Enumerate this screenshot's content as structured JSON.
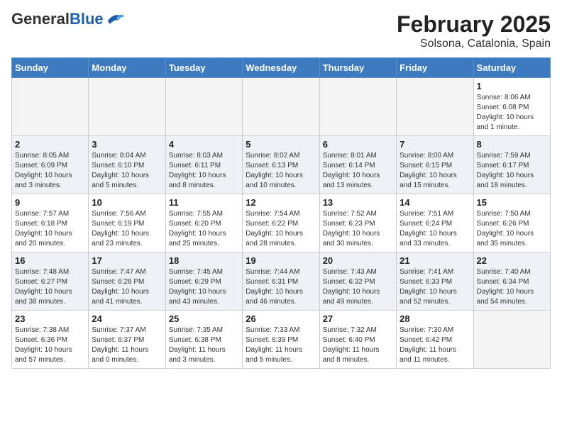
{
  "logo": {
    "general": "General",
    "blue": "Blue"
  },
  "title": "February 2025",
  "location": "Solsona, Catalonia, Spain",
  "days_of_week": [
    "Sunday",
    "Monday",
    "Tuesday",
    "Wednesday",
    "Thursday",
    "Friday",
    "Saturday"
  ],
  "weeks": [
    [
      {
        "day": "",
        "info": ""
      },
      {
        "day": "",
        "info": ""
      },
      {
        "day": "",
        "info": ""
      },
      {
        "day": "",
        "info": ""
      },
      {
        "day": "",
        "info": ""
      },
      {
        "day": "",
        "info": ""
      },
      {
        "day": "1",
        "info": "Sunrise: 8:06 AM\nSunset: 6:08 PM\nDaylight: 10 hours\nand 1 minute."
      }
    ],
    [
      {
        "day": "2",
        "info": "Sunrise: 8:05 AM\nSunset: 6:09 PM\nDaylight: 10 hours\nand 3 minutes."
      },
      {
        "day": "3",
        "info": "Sunrise: 8:04 AM\nSunset: 6:10 PM\nDaylight: 10 hours\nand 5 minutes."
      },
      {
        "day": "4",
        "info": "Sunrise: 8:03 AM\nSunset: 6:11 PM\nDaylight: 10 hours\nand 8 minutes."
      },
      {
        "day": "5",
        "info": "Sunrise: 8:02 AM\nSunset: 6:13 PM\nDaylight: 10 hours\nand 10 minutes."
      },
      {
        "day": "6",
        "info": "Sunrise: 8:01 AM\nSunset: 6:14 PM\nDaylight: 10 hours\nand 13 minutes."
      },
      {
        "day": "7",
        "info": "Sunrise: 8:00 AM\nSunset: 6:15 PM\nDaylight: 10 hours\nand 15 minutes."
      },
      {
        "day": "8",
        "info": "Sunrise: 7:59 AM\nSunset: 6:17 PM\nDaylight: 10 hours\nand 18 minutes."
      }
    ],
    [
      {
        "day": "9",
        "info": "Sunrise: 7:57 AM\nSunset: 6:18 PM\nDaylight: 10 hours\nand 20 minutes."
      },
      {
        "day": "10",
        "info": "Sunrise: 7:56 AM\nSunset: 6:19 PM\nDaylight: 10 hours\nand 23 minutes."
      },
      {
        "day": "11",
        "info": "Sunrise: 7:55 AM\nSunset: 6:20 PM\nDaylight: 10 hours\nand 25 minutes."
      },
      {
        "day": "12",
        "info": "Sunrise: 7:54 AM\nSunset: 6:22 PM\nDaylight: 10 hours\nand 28 minutes."
      },
      {
        "day": "13",
        "info": "Sunrise: 7:52 AM\nSunset: 6:23 PM\nDaylight: 10 hours\nand 30 minutes."
      },
      {
        "day": "14",
        "info": "Sunrise: 7:51 AM\nSunset: 6:24 PM\nDaylight: 10 hours\nand 33 minutes."
      },
      {
        "day": "15",
        "info": "Sunrise: 7:50 AM\nSunset: 6:26 PM\nDaylight: 10 hours\nand 35 minutes."
      }
    ],
    [
      {
        "day": "16",
        "info": "Sunrise: 7:48 AM\nSunset: 6:27 PM\nDaylight: 10 hours\nand 38 minutes."
      },
      {
        "day": "17",
        "info": "Sunrise: 7:47 AM\nSunset: 6:28 PM\nDaylight: 10 hours\nand 41 minutes."
      },
      {
        "day": "18",
        "info": "Sunrise: 7:45 AM\nSunset: 6:29 PM\nDaylight: 10 hours\nand 43 minutes."
      },
      {
        "day": "19",
        "info": "Sunrise: 7:44 AM\nSunset: 6:31 PM\nDaylight: 10 hours\nand 46 minutes."
      },
      {
        "day": "20",
        "info": "Sunrise: 7:43 AM\nSunset: 6:32 PM\nDaylight: 10 hours\nand 49 minutes."
      },
      {
        "day": "21",
        "info": "Sunrise: 7:41 AM\nSunset: 6:33 PM\nDaylight: 10 hours\nand 52 minutes."
      },
      {
        "day": "22",
        "info": "Sunrise: 7:40 AM\nSunset: 6:34 PM\nDaylight: 10 hours\nand 54 minutes."
      }
    ],
    [
      {
        "day": "23",
        "info": "Sunrise: 7:38 AM\nSunset: 6:36 PM\nDaylight: 10 hours\nand 57 minutes."
      },
      {
        "day": "24",
        "info": "Sunrise: 7:37 AM\nSunset: 6:37 PM\nDaylight: 11 hours\nand 0 minutes."
      },
      {
        "day": "25",
        "info": "Sunrise: 7:35 AM\nSunset: 6:38 PM\nDaylight: 11 hours\nand 3 minutes."
      },
      {
        "day": "26",
        "info": "Sunrise: 7:33 AM\nSunset: 6:39 PM\nDaylight: 11 hours\nand 5 minutes."
      },
      {
        "day": "27",
        "info": "Sunrise: 7:32 AM\nSunset: 6:40 PM\nDaylight: 11 hours\nand 8 minutes."
      },
      {
        "day": "28",
        "info": "Sunrise: 7:30 AM\nSunset: 6:42 PM\nDaylight: 11 hours\nand 11 minutes."
      },
      {
        "day": "",
        "info": ""
      }
    ]
  ]
}
